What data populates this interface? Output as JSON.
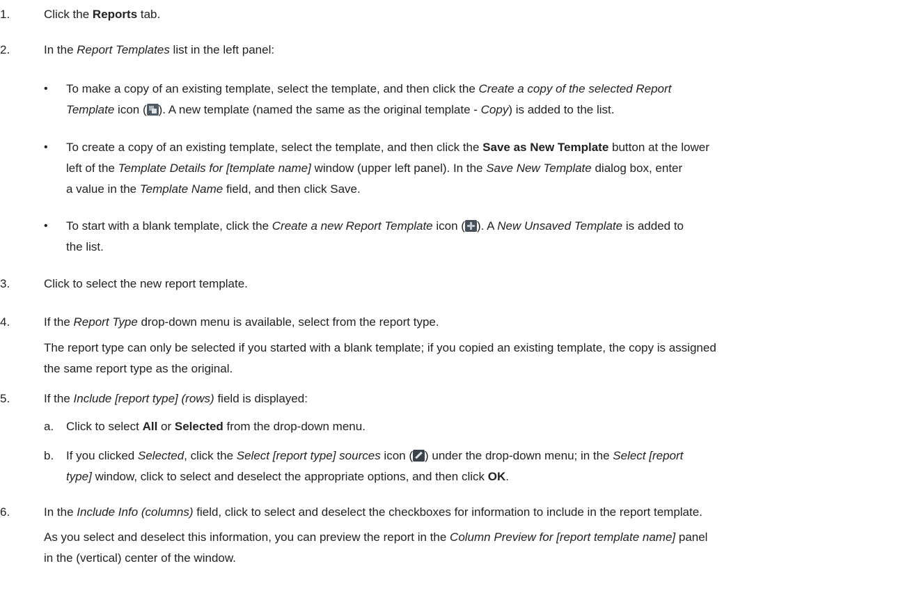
{
  "steps": [
    {
      "num": "1.",
      "t1": "Click the ",
      "b1": "Reports",
      "t2": " tab."
    },
    {
      "num": "2.",
      "t1": "In the ",
      "i1": "Report Templates",
      "t2": " list in the left panel:"
    },
    {
      "num": "3.",
      "text": "Click to select the new report template."
    },
    {
      "num": "4.",
      "t1": "If the ",
      "i1": "Report Type",
      "t2": " drop-down menu is available, select from the report type.",
      "para_l1": "The report type can only be selected if you started with a blank template; if you copied an existing template, the copy is assigned",
      "para_l2": "the same report type as the original."
    },
    {
      "num": "5.",
      "t1": "If the ",
      "i1": "Include [report type] (rows)",
      "t2": " field is displayed:"
    },
    {
      "num": "6.",
      "t1": "In the ",
      "i1": "Include Info (columns)",
      "t2": " field, click to select and deselect the checkboxes for information to include in the report template.",
      "para_l1a": "As you select and deselect this information, you can preview the report in the ",
      "para_l1i": "Column Preview for [report template name]",
      "para_l1b": " panel",
      "para_l2": "in the (vertical) center of the window."
    }
  ],
  "bullets": [
    {
      "dot": "•",
      "l1a": "To make a copy of an existing template, select the template, and then click the ",
      "l1i": "Create a copy of the selected Report",
      "l2i": "Template",
      "l2a": " icon (",
      "l2b": "). A new template (named the same as the original template - ",
      "l2i2": "Copy",
      "l2c": ") is added to the list.",
      "icon": "copy-icon"
    },
    {
      "dot": "•",
      "l1a": "To create a copy of an existing template, select the template, and then click the ",
      "l1b": "Save as New Template",
      "l1c": " button at the lower",
      "l2a": "left of the ",
      "l2i": "Template Details for [template name]",
      "l2b": " window (upper left panel). In the ",
      "l2i2": "Save New Template",
      "l2c": " dialog box, enter",
      "l3a": "a value in the ",
      "l3i": "Template Name",
      "l3b": " field, and then click Save."
    },
    {
      "dot": "•",
      "l1a": "To start with a blank template, click the ",
      "l1i": "Create a new Report Template",
      "l1b": " icon (",
      "l1c": "). A ",
      "l1i2": "New Unsaved Template",
      "l1d": " is added to",
      "l2a": "the list.",
      "icon": "plus-icon"
    }
  ],
  "substeps": [
    {
      "letter": "a.",
      "t1": "Click to select ",
      "b1": "All",
      "t2": " or ",
      "b2": "Selected",
      "t3": " from the drop-down menu."
    },
    {
      "letter": "b.",
      "t1": "If you clicked ",
      "i1": "Selected",
      "t2": ", click the ",
      "i2": "Select [report type] sources",
      "t3": " icon (",
      "t4": ") under the drop-down menu; in the ",
      "i3": "Select [report",
      "l2i": "type]",
      "l2a": " window, click to select and deselect the appropriate options, and then click ",
      "l2b": "OK",
      "l2c": ".",
      "icon": "pencil-icon"
    }
  ]
}
